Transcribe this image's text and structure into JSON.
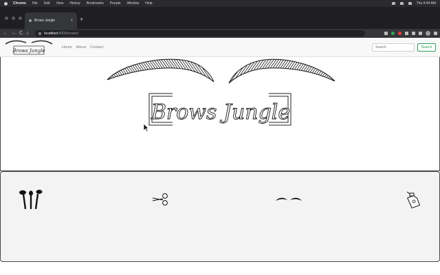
{
  "menubar": {
    "app": "Chrome",
    "items": [
      "File",
      "Edit",
      "View",
      "History",
      "Bookmarks",
      "People",
      "Window",
      "Help"
    ],
    "clock": "Thu 9:44 AM"
  },
  "browser": {
    "tab_title": "Brows Jungle",
    "new_tab": "+",
    "url_host": "localhost",
    "url_path": ":8000/contact",
    "back": "←",
    "forward": "→",
    "reload": "C",
    "home": "⌂"
  },
  "site": {
    "brand_text": "Brows Jungle",
    "nav": [
      "Home",
      "About",
      "Contact"
    ],
    "search_placeholder": "Search",
    "search_button": "Search"
  },
  "hero": {
    "logo_text": "Brows Jungle"
  },
  "services": {
    "icons": [
      "makeup-brushes-icon",
      "scissors-icon",
      "eyebrows-icon",
      "spray-bottle-icon"
    ]
  },
  "colors": {
    "accent_green": "#2e9e59",
    "panel_bg": "#f3f3f3",
    "chrome_dark": "#35363a"
  }
}
